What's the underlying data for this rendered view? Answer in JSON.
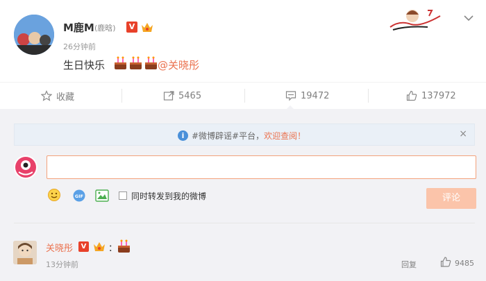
{
  "post": {
    "username": "M鹿M",
    "user_handle": "(鹿晗)",
    "verified_badge": "V",
    "timestamp": "26分钟前",
    "text": "生日快乐",
    "emoji": "cake-icon",
    "mention": "@关晓彤",
    "accent": "#eb7350"
  },
  "actions": {
    "favorite_label": "收藏",
    "repost_count": "5465",
    "comment_count": "19472",
    "like_count": "137972"
  },
  "comments": {
    "notice_prefix": "#微博辟谣#平台，",
    "notice_link": "欢迎查阅！",
    "notice_close": "×",
    "input_value": "",
    "repost_label": "同时转发到我的微博",
    "submit_label": "评论",
    "items": [
      {
        "name": "关晓彤",
        "badge": "V",
        "colon": "：",
        "time": "13分钟前",
        "reply_label": "回复",
        "likes": "9485"
      }
    ]
  }
}
